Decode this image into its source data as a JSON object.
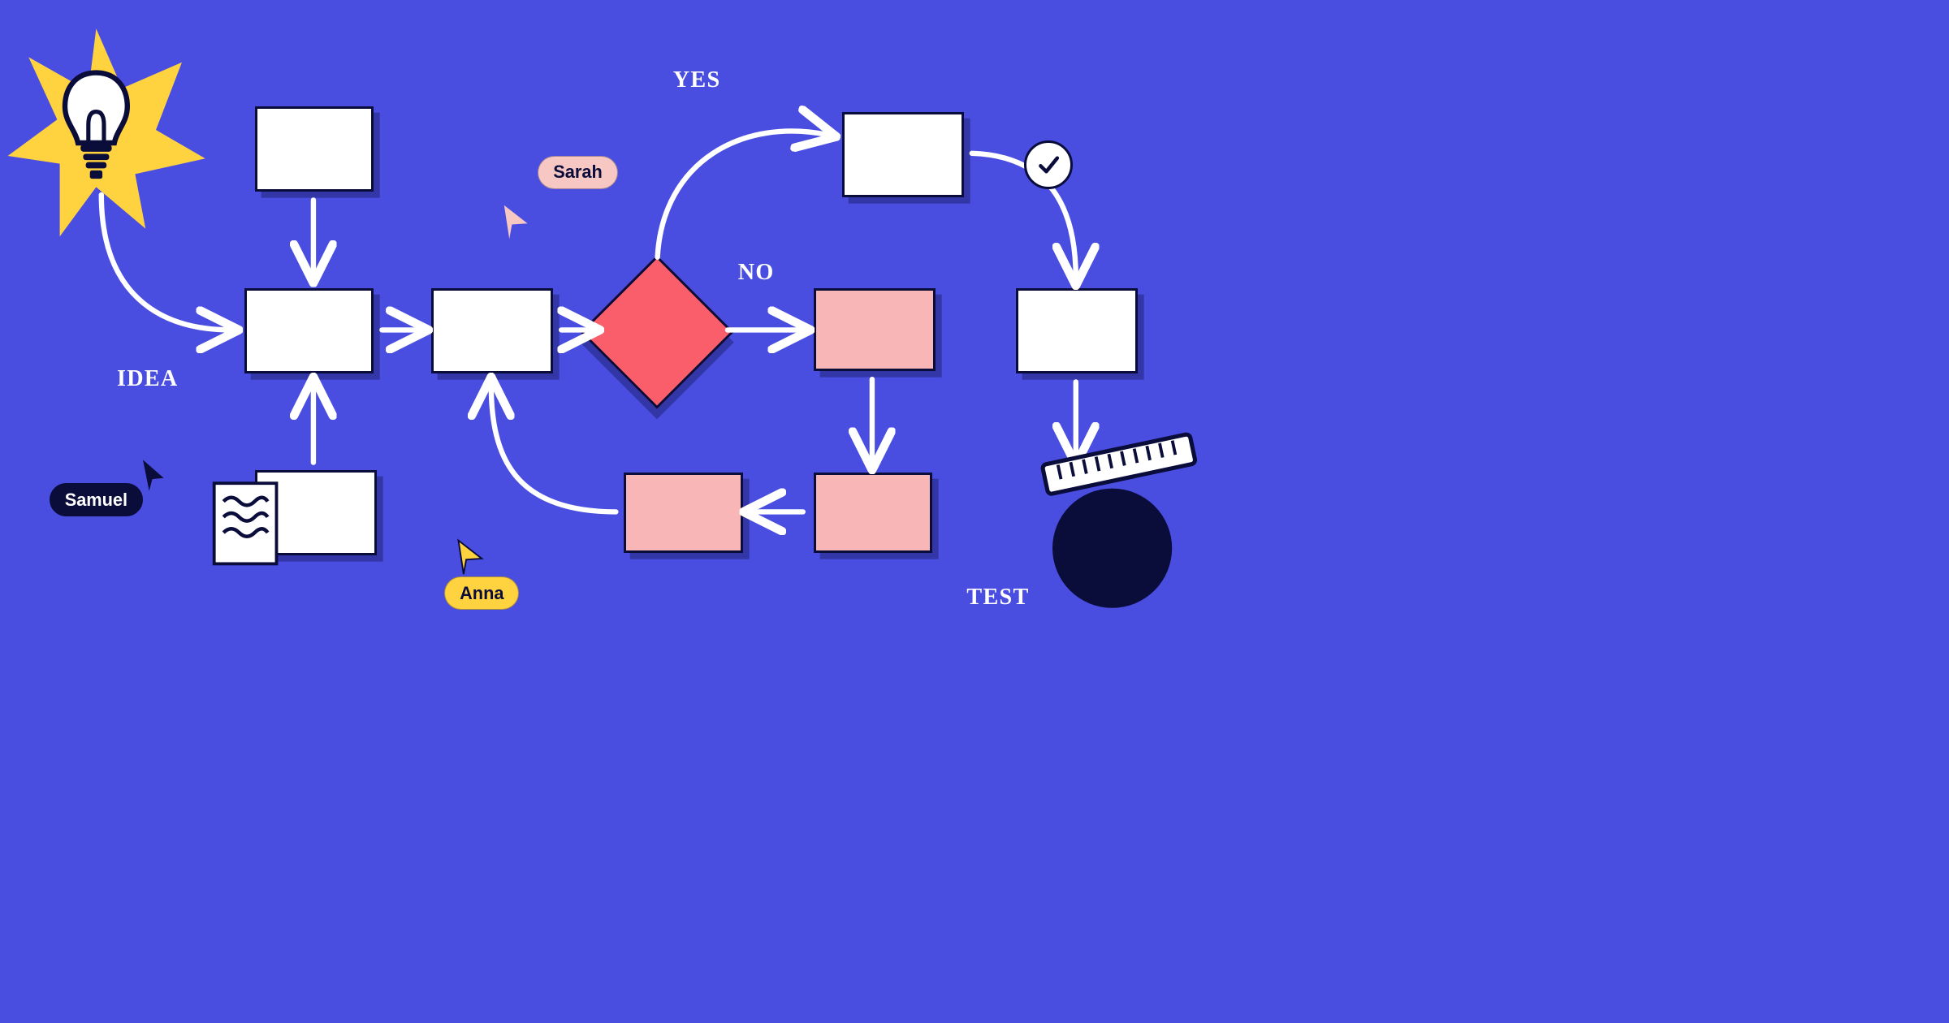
{
  "labels": {
    "idea": "IDEA",
    "yes": "YES",
    "no": "NO",
    "test": "TEST"
  },
  "users": {
    "samuel": "Samuel",
    "sarah": "Sarah",
    "anna": "Anna"
  },
  "colors": {
    "background": "#4A4EE0",
    "stroke": "#0A0C3A",
    "white": "#FFFFFF",
    "pink_fill": "#F8B6B6",
    "decision_fill": "#F95E6A",
    "yellow": "#FFD23F",
    "tag_pink": "#F6C7C3"
  },
  "diagram": {
    "type": "flowchart",
    "nodes": [
      {
        "id": "idea-source",
        "kind": "graphic-lightbulb"
      },
      {
        "id": "box-top",
        "kind": "process",
        "fill": "white"
      },
      {
        "id": "box-main",
        "kind": "process",
        "fill": "white",
        "label_ref": "IDEA"
      },
      {
        "id": "box-doc",
        "kind": "process-with-document",
        "fill": "white"
      },
      {
        "id": "box-mid",
        "kind": "process",
        "fill": "white"
      },
      {
        "id": "decision",
        "kind": "decision",
        "fill": "red"
      },
      {
        "id": "box-yes",
        "kind": "process",
        "fill": "white",
        "branch": "YES"
      },
      {
        "id": "box-no-right",
        "kind": "process",
        "fill": "pink",
        "branch": "NO"
      },
      {
        "id": "box-no-below",
        "kind": "process",
        "fill": "pink"
      },
      {
        "id": "box-no-left",
        "kind": "process",
        "fill": "pink"
      },
      {
        "id": "box-after-yes",
        "kind": "process",
        "fill": "white"
      },
      {
        "id": "test-graphic",
        "kind": "graphic-balance",
        "label_ref": "TEST"
      }
    ],
    "edges": [
      {
        "from": "idea-source",
        "to": "box-main",
        "style": "curved"
      },
      {
        "from": "box-top",
        "to": "box-main"
      },
      {
        "from": "box-doc",
        "to": "box-main"
      },
      {
        "from": "box-main",
        "to": "box-mid"
      },
      {
        "from": "box-mid",
        "to": "decision"
      },
      {
        "from": "decision",
        "to": "box-yes",
        "label": "YES",
        "style": "curved"
      },
      {
        "from": "decision",
        "to": "box-no-right",
        "label": "NO"
      },
      {
        "from": "box-no-right",
        "to": "box-no-below"
      },
      {
        "from": "box-no-below",
        "to": "box-no-left"
      },
      {
        "from": "box-no-left",
        "to": "box-mid",
        "style": "curved"
      },
      {
        "from": "box-yes",
        "to": "box-after-yes",
        "style": "curved-with-check"
      },
      {
        "from": "box-after-yes",
        "to": "test-graphic"
      }
    ],
    "cursors": [
      {
        "user": "Samuel",
        "color": "dark"
      },
      {
        "user": "Sarah",
        "color": "pink"
      },
      {
        "user": "Anna",
        "color": "yellow"
      }
    ]
  }
}
